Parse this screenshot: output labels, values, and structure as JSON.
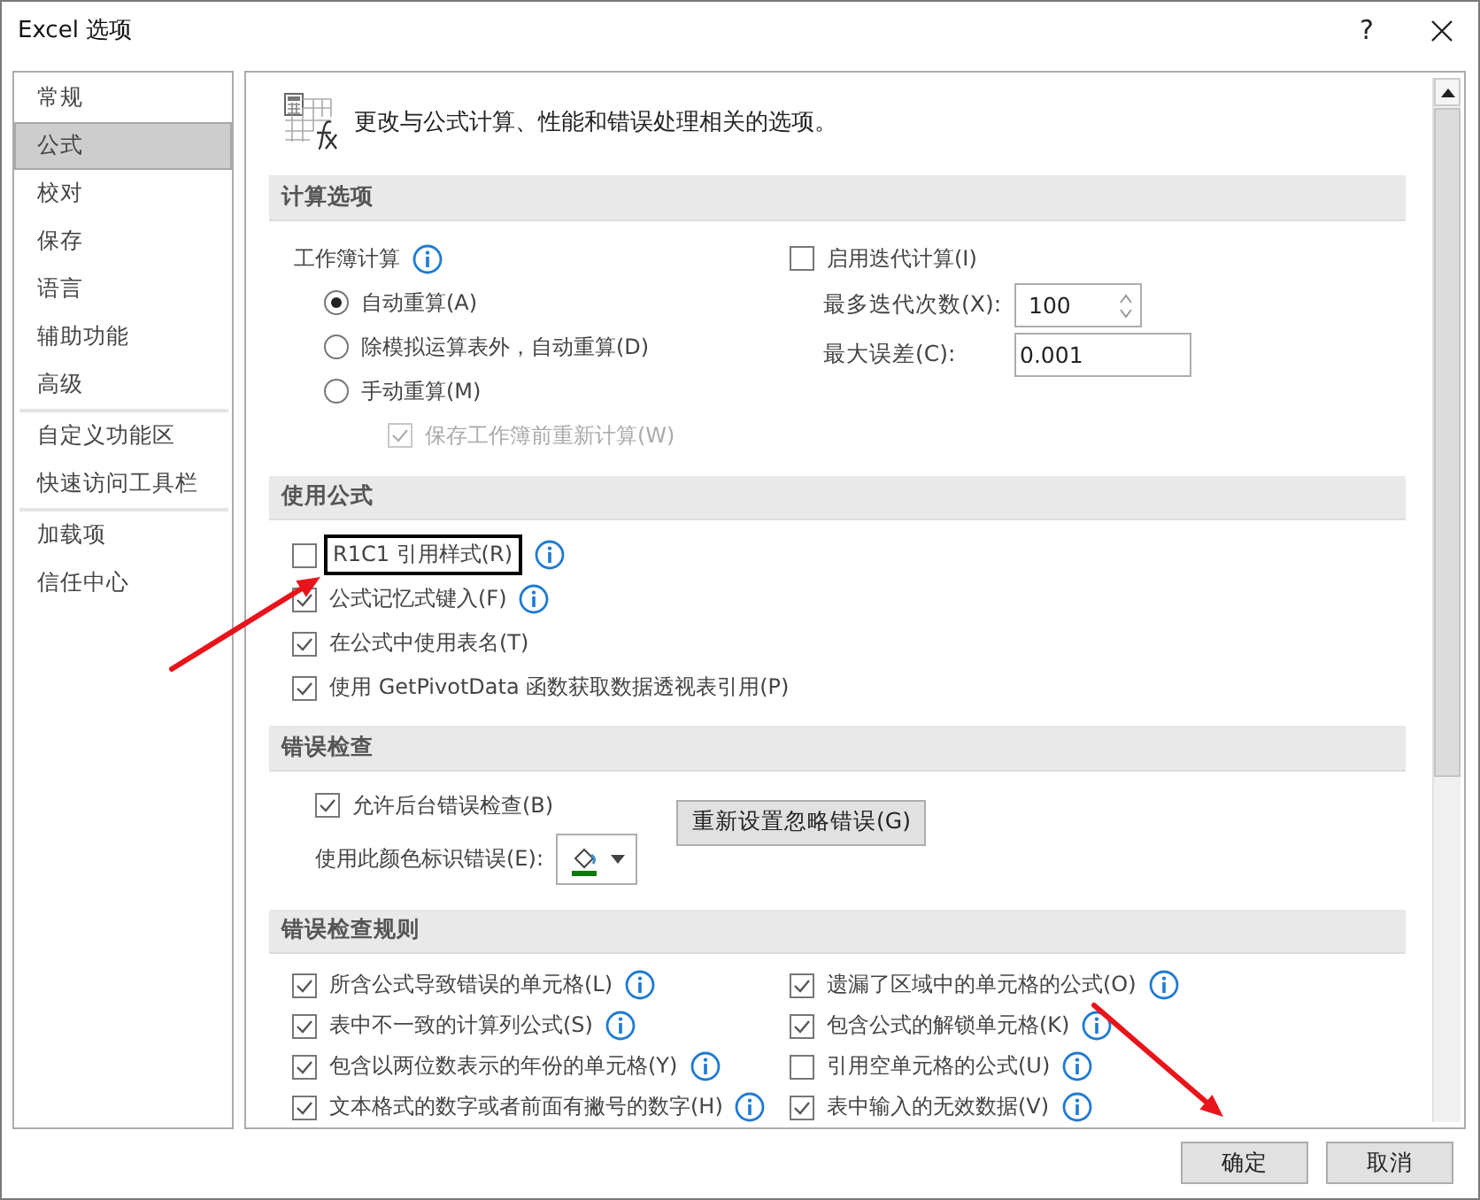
{
  "window": {
    "title": "Excel 选项",
    "help_button": "?"
  },
  "sidebar": {
    "items": [
      {
        "label": "常规",
        "selected": false,
        "separator_after": false
      },
      {
        "label": "公式",
        "selected": true,
        "separator_after": false
      },
      {
        "label": "校对",
        "selected": false,
        "separator_after": false
      },
      {
        "label": "保存",
        "selected": false,
        "separator_after": false
      },
      {
        "label": "语言",
        "selected": false,
        "separator_after": false
      },
      {
        "label": "辅助功能",
        "selected": false,
        "separator_after": false
      },
      {
        "label": "高级",
        "selected": false,
        "separator_after": true
      },
      {
        "label": "自定义功能区",
        "selected": false,
        "separator_after": false
      },
      {
        "label": "快速访问工具栏",
        "selected": false,
        "separator_after": true
      },
      {
        "label": "加载项",
        "selected": false,
        "separator_after": false
      },
      {
        "label": "信任中心",
        "selected": false,
        "separator_after": false
      }
    ]
  },
  "header": {
    "text": "更改与公式计算、性能和错误处理相关的选项。"
  },
  "calculation": {
    "title": "计算选项",
    "workbook_label": "工作簿计算",
    "modes": [
      {
        "label": "自动重算(A)",
        "selected": true
      },
      {
        "label": "除模拟运算表外，自动重算(D)",
        "selected": false
      },
      {
        "label": "手动重算(M)",
        "selected": false
      }
    ],
    "save_before": {
      "label": "保存工作簿前重新计算(W)",
      "checked": true,
      "disabled": true
    },
    "iterative": {
      "label": "启用迭代计算(I)",
      "checked": false
    },
    "max_iterations": {
      "label": "最多迭代次数(X):",
      "value": "100"
    },
    "max_change": {
      "label": "最大误差(C):",
      "value": "0.001"
    }
  },
  "formulas": {
    "title": "使用公式",
    "options": [
      {
        "label": "R1C1 引用样式(R)",
        "checked": false,
        "info": true,
        "highlighted": true
      },
      {
        "label": "公式记忆式键入(F)",
        "checked": true,
        "info": true,
        "highlighted": false
      },
      {
        "label": "在公式中使用表名(T)",
        "checked": true,
        "info": false,
        "highlighted": false
      },
      {
        "label": "使用 GetPivotData 函数获取数据透视表引用(P)",
        "checked": true,
        "info": false,
        "highlighted": false
      }
    ]
  },
  "error_checking": {
    "title": "错误检查",
    "background": {
      "label": "允许后台错误检查(B)",
      "checked": true
    },
    "color_label": "使用此颜色标识错误(E):",
    "reset_button": "重新设置忽略错误(G)"
  },
  "rules": {
    "title": "错误检查规则",
    "left": [
      {
        "label": "所含公式导致错误的单元格(L)",
        "checked": true
      },
      {
        "label": "表中不一致的计算列公式(S)",
        "checked": true
      },
      {
        "label": "包含以两位数表示的年份的单元格(Y)",
        "checked": true
      },
      {
        "label": "文本格式的数字或者前面有撇号的数字(H)",
        "checked": true
      }
    ],
    "right": [
      {
        "label": "遗漏了区域中的单元格的公式(O)",
        "checked": true
      },
      {
        "label": "包含公式的解锁单元格(K)",
        "checked": true
      },
      {
        "label": "引用空单元格的公式(U)",
        "checked": false
      },
      {
        "label": "表中输入的无效数据(V)",
        "checked": true
      }
    ]
  },
  "buttons": [
    "确定",
    "取消"
  ],
  "annotations": [
    {
      "kind": "arrow"
    },
    {
      "kind": "arrow"
    }
  ]
}
